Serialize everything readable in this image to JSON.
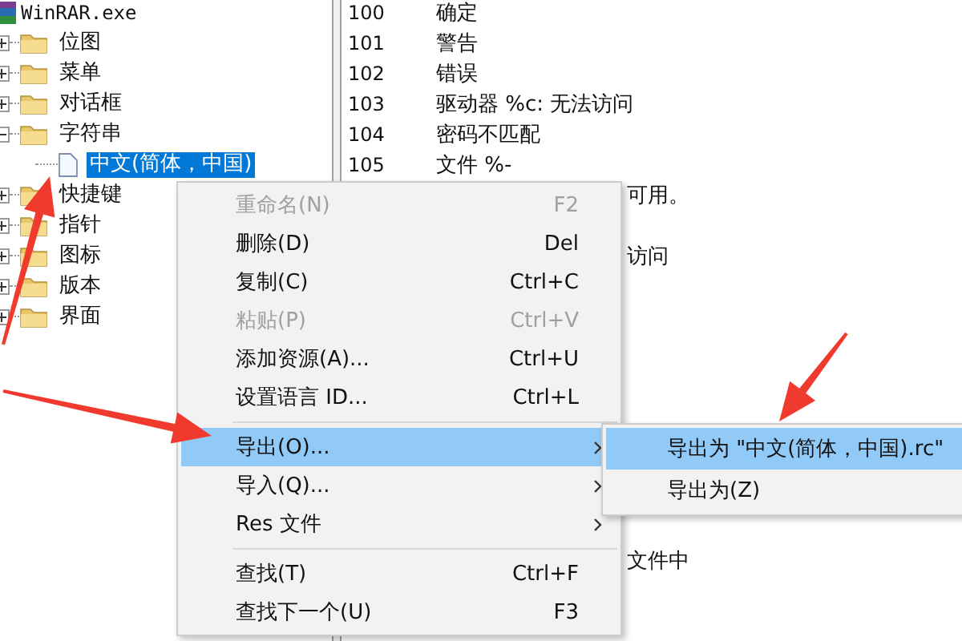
{
  "tree": {
    "root": "WinRAR.exe",
    "items": [
      {
        "label": "位图",
        "expanded": false
      },
      {
        "label": "菜单",
        "expanded": false
      },
      {
        "label": "对话框",
        "expanded": false
      },
      {
        "label": "字符串",
        "expanded": true,
        "children": [
          {
            "label": "中文(简体，中国)",
            "selected": true
          }
        ]
      },
      {
        "label": "快捷键",
        "expanded": false
      },
      {
        "label": "指针",
        "expanded": false
      },
      {
        "label": "图标",
        "expanded": false
      },
      {
        "label": "版本",
        "expanded": false
      },
      {
        "label": "界面",
        "expanded": false
      }
    ]
  },
  "strings": [
    {
      "kind": "row",
      "id": "100",
      "text": "确定"
    },
    {
      "kind": "row",
      "id": "101",
      "text": "警告"
    },
    {
      "kind": "row",
      "id": "102",
      "text": "错误"
    },
    {
      "kind": "row",
      "id": "103",
      "text": "驱动器 %c: 无法访问"
    },
    {
      "kind": "row",
      "id": "104",
      "text": "密码不匹配"
    },
    {
      "kind": "row",
      "id": "105",
      "text": "文件 %-"
    },
    {
      "kind": "tail",
      "text": "可用。"
    },
    {
      "kind": "covered"
    },
    {
      "kind": "tail",
      "text": "访问"
    },
    {
      "kind": "covered"
    },
    {
      "kind": "covered"
    },
    {
      "kind": "covered"
    },
    {
      "kind": "covered"
    },
    {
      "kind": "covered"
    },
    {
      "kind": "covered"
    },
    {
      "kind": "covered"
    },
    {
      "kind": "covered"
    },
    {
      "kind": "covered"
    },
    {
      "kind": "tail",
      "text": "文件中"
    }
  ],
  "context_menu": [
    {
      "kind": "item",
      "label": "重命名(N)",
      "shortcut": "F2",
      "disabled": true,
      "selected": false
    },
    {
      "kind": "item",
      "label": "删除(D)",
      "shortcut": "Del",
      "disabled": false,
      "selected": false
    },
    {
      "kind": "item",
      "label": "复制(C)",
      "shortcut": "Ctrl+C",
      "disabled": false,
      "selected": false
    },
    {
      "kind": "item",
      "label": "粘贴(P)",
      "shortcut": "Ctrl+V",
      "disabled": true,
      "selected": false
    },
    {
      "kind": "item",
      "label": "添加资源(A)...",
      "shortcut": "Ctrl+U",
      "disabled": false,
      "selected": false
    },
    {
      "kind": "item",
      "label": "设置语言 ID...",
      "shortcut": "Ctrl+L",
      "disabled": false,
      "selected": false
    },
    {
      "kind": "separator"
    },
    {
      "kind": "submenu",
      "label": "导出(O)...",
      "disabled": false,
      "selected": true
    },
    {
      "kind": "submenu",
      "label": "导入(Q)...",
      "disabled": false,
      "selected": false
    },
    {
      "kind": "submenu",
      "label": "Res 文件",
      "disabled": false,
      "selected": false
    },
    {
      "kind": "separator"
    },
    {
      "kind": "item",
      "label": "查找(T)",
      "shortcut": "Ctrl+F",
      "disabled": false,
      "selected": false
    },
    {
      "kind": "item",
      "label": "查找下一个(U)",
      "shortcut": "F3",
      "disabled": false,
      "selected": false
    }
  ],
  "submenu": [
    {
      "label": "导出为 \"中文(简体，中国).rc\"",
      "selected": true
    },
    {
      "label": "导出为(Z)",
      "selected": false
    }
  ]
}
